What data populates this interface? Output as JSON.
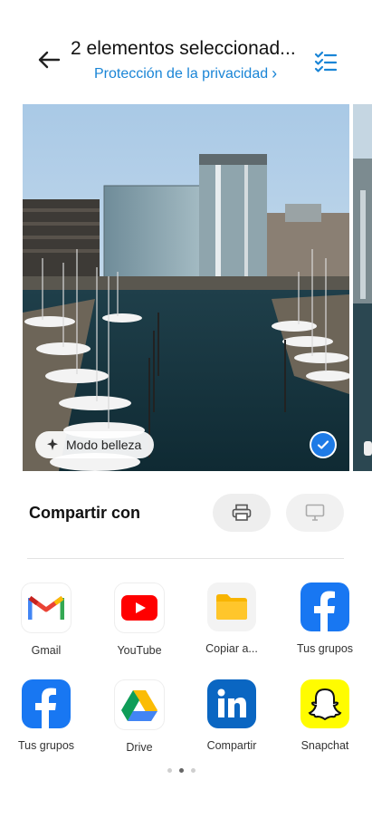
{
  "header": {
    "title": "2 elementos seleccionad...",
    "privacy_link": "Protección de la privacidad",
    "privacy_chevron": "›"
  },
  "photo": {
    "badge_label": "Modo belleza",
    "selected": true
  },
  "share": {
    "title": "Compartir con"
  },
  "apps": [
    {
      "label": "Gmail",
      "icon": "gmail-icon"
    },
    {
      "label": "YouTube",
      "icon": "youtube-icon"
    },
    {
      "label": "Copiar a...",
      "icon": "folder-icon"
    },
    {
      "label": "Tus grupos",
      "icon": "facebook-icon"
    },
    {
      "label": "Tus grupos",
      "icon": "facebook-icon"
    },
    {
      "label": "Drive",
      "icon": "drive-icon"
    },
    {
      "label": "Compartir",
      "icon": "linkedin-icon"
    },
    {
      "label": "Snapchat",
      "icon": "snapchat-icon"
    }
  ],
  "pager": {
    "count": 3,
    "active": 1
  },
  "colors": {
    "accent": "#1a85d6",
    "check": "#1e7be6"
  }
}
